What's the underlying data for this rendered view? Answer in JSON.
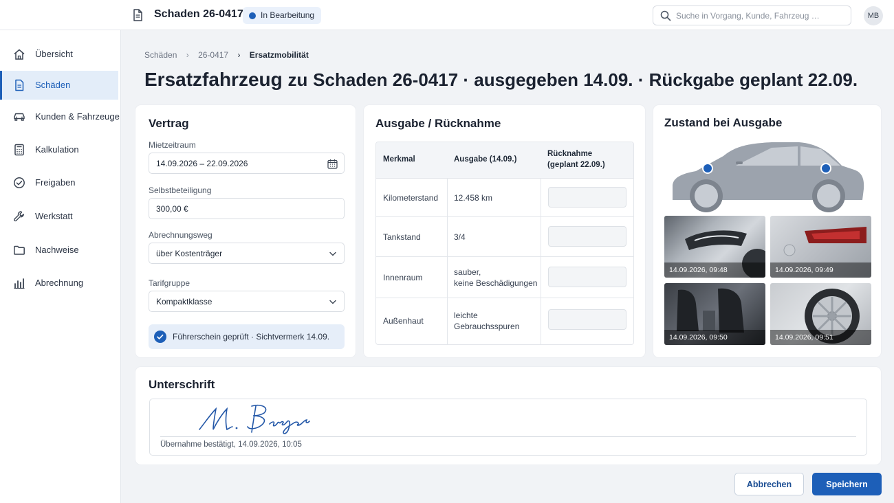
{
  "header": {
    "title": "Schaden 26-0417",
    "status_badge": "In Bearbeitung",
    "search_placeholder": "Suche in Vorgang, Kunde, Fahrzeug …",
    "user_initials": "MB"
  },
  "sidebar": {
    "items": [
      {
        "label": "Übersicht",
        "icon": "home-icon"
      },
      {
        "label": "Schäden",
        "icon": "document-icon",
        "active": true
      },
      {
        "label": "Kunden & Fahrzeuge",
        "icon": "car-icon"
      },
      {
        "label": "Kalkulation",
        "icon": "calculator-icon"
      },
      {
        "label": "Freigaben",
        "icon": "check-circle-icon"
      },
      {
        "label": "Werkstatt",
        "icon": "wrench-icon"
      },
      {
        "label": "Nachweise",
        "icon": "folder-icon"
      },
      {
        "label": "Abrechnung",
        "icon": "bar-chart-icon"
      }
    ]
  },
  "breadcrumb": [
    "Schäden",
    "26-0417",
    "Ersatzmobilität"
  ],
  "page": {
    "title_main": "Ersatzfahrzeug",
    "title_small": "zu",
    "title_rest": "Schaden 26-0417 · ausgegeben 14.09. · Rückgabe geplant 22.09."
  },
  "contract": {
    "title": "Vertrag",
    "rental_period_label": "Mietzeitraum",
    "rental_period_value": "14.09.2026 – 22.09.2026",
    "deductible_label": "Selbstbeteiligung",
    "deductible_value": "300,00 €",
    "billing_label": "Abrechnungsweg",
    "billing_value": "über Kostenträger",
    "tariff_label": "Tarifgruppe",
    "tariff_value": "Kompaktklasse",
    "license_check": "Führerschein geprüft · Sichtvermerk 14.09."
  },
  "handover": {
    "title": "Ausgabe / Rücknahme",
    "columns": [
      "Merkmal",
      "Ausgabe (14.09.)",
      "Rücknahme\n(geplant 22.09.)"
    ],
    "column_0": "Merkmal",
    "column_1": "Ausgabe (14.09.)",
    "column_2_line1": "Rücknahme",
    "column_2_line2": "(geplant 22.09.)",
    "rows": [
      {
        "feature": "Kilometerstand",
        "issue_line1": "12.458 km",
        "issue_line2": ""
      },
      {
        "feature": "Tankstand",
        "issue_line1": "3/4",
        "issue_line2": ""
      },
      {
        "feature": "Innenraum",
        "issue_line1": "sauber,",
        "issue_line2": "keine Beschädigungen"
      },
      {
        "feature": "Außenhaut",
        "issue_line1": "leichte",
        "issue_line2": "Gebrauchsspuren"
      }
    ]
  },
  "condition": {
    "title": "Zustand bei Ausgabe",
    "photos": [
      {
        "timestamp": "14.09.2026, 09:48",
        "subject": "headlight"
      },
      {
        "timestamp": "14.09.2026, 09:49",
        "subject": "taillight"
      },
      {
        "timestamp": "14.09.2026, 09:50",
        "subject": "interior"
      },
      {
        "timestamp": "14.09.2026, 09:51",
        "subject": "wheel"
      }
    ]
  },
  "signature": {
    "title": "Unterschrift",
    "name": "M. Berger",
    "confirmation": "Übernahme bestätigt, 14.09.2026, 10:05"
  },
  "actions": {
    "cancel": "Abbrechen",
    "save": "Speichern"
  },
  "colors": {
    "accent": "#1d5fb8",
    "background": "#f1f3f6"
  }
}
